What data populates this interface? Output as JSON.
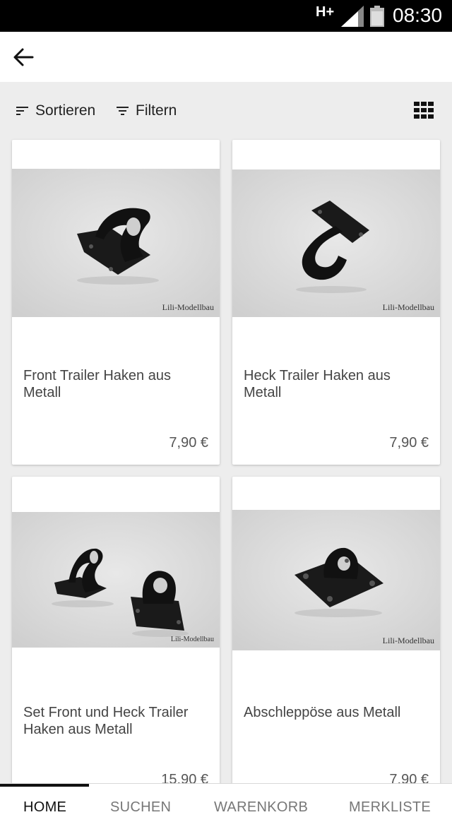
{
  "status_bar": {
    "network": "H+",
    "time": "08:30",
    "icons": [
      "signal-icon",
      "battery-icon"
    ]
  },
  "app_bar": {
    "back_icon": "arrow-left-icon"
  },
  "toolbar": {
    "sort_label": "Sortieren",
    "filter_label": "Filtern",
    "icons": [
      "sort-icon",
      "filter-icon",
      "grid-view-icon"
    ]
  },
  "products": [
    {
      "title": "Front Trailer Haken aus Metall",
      "price": "7,90 €",
      "watermark": "Lili-Modellbau"
    },
    {
      "title": "Heck Trailer Haken aus Metall",
      "price": "7,90 €",
      "watermark": "Lili-Modellbau"
    },
    {
      "title": "Set Front und Heck Trailer Haken aus Metall",
      "price": "15,90 €",
      "watermark": "Lili-Modellbau"
    },
    {
      "title": "Abschleppöse aus Metall",
      "price": "7,90 €",
      "watermark": "Lili-Modellbau"
    }
  ],
  "bottom_nav": {
    "items": [
      "HOME",
      "SUCHEN",
      "WARENKORB",
      "MERKLISTE"
    ],
    "active": "HOME"
  },
  "colors": {
    "status_bar": "#000000",
    "background": "#ededed",
    "card": "#ffffff",
    "photo_bg": "#dcdcdc",
    "active_nav": "#111111",
    "inactive_nav": "#777777"
  }
}
